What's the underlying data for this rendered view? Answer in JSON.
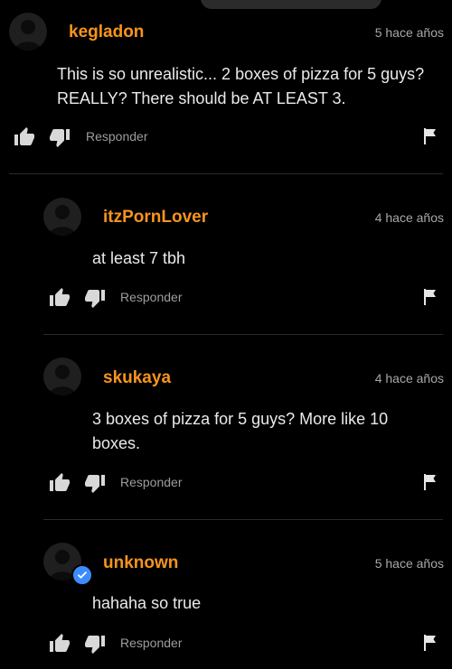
{
  "comments": [
    {
      "author": "kegladon",
      "time": "5 hace años",
      "text": "This is so unrealistic... 2 boxes of pizza for 5 guys? REALLY? There should be AT LEAST 3.",
      "reply_label": "Responder",
      "verified": false
    },
    {
      "author": "itzPornLover",
      "time": "4 hace años",
      "text": "at least 7 tbh",
      "reply_label": "Responder",
      "verified": false
    },
    {
      "author": "skukaya",
      "time": "4 hace años",
      "text": "3 boxes of pizza for 5 guys? More like 10 boxes.",
      "reply_label": "Responder",
      "verified": false
    },
    {
      "author": "unknown",
      "time": "5 hace años",
      "text": "hahaha so true",
      "reply_label": "Responder",
      "verified": true
    }
  ],
  "colors": {
    "author": "#f7941d",
    "background": "#000000",
    "verified_badge": "#3d8cff"
  },
  "icons": [
    "user-avatar-icon",
    "thumbs-up-icon",
    "thumbs-down-icon",
    "flag-icon",
    "verified-check-icon"
  ]
}
